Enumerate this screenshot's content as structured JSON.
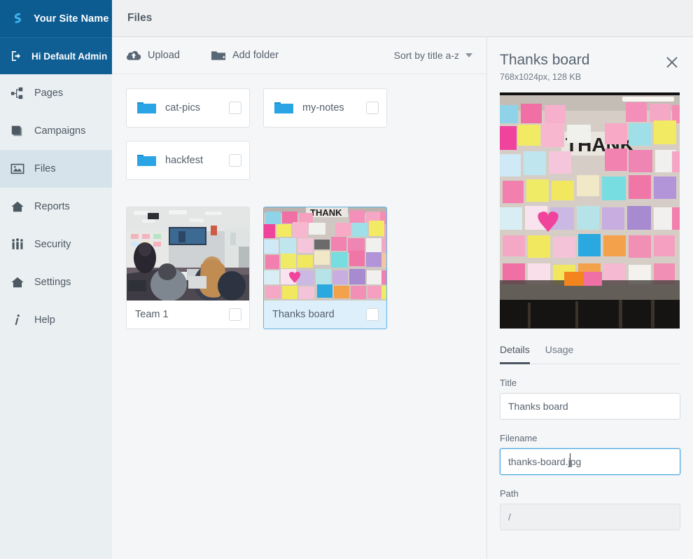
{
  "brand": {
    "logo_icon": "s-swirl-logo",
    "name": "Your Site Name",
    "user_icon": "logout-arrow-icon",
    "user_greeting": "Hi Default Admin",
    "header_bg": "#0d5c91",
    "accent": "#29a3e0"
  },
  "sidebar": {
    "items": [
      {
        "label": "Pages",
        "icon": "sitemap-icon",
        "active": false
      },
      {
        "label": "Campaigns",
        "icon": "layers-icon",
        "active": false
      },
      {
        "label": "Files",
        "icon": "image-icon",
        "active": true
      },
      {
        "label": "Reports",
        "icon": "home-icon",
        "active": false
      },
      {
        "label": "Security",
        "icon": "people-icon",
        "active": false
      },
      {
        "label": "Settings",
        "icon": "home-icon",
        "active": false
      },
      {
        "label": "Help",
        "icon": "info-i-icon",
        "active": false
      }
    ]
  },
  "page": {
    "title": "Files"
  },
  "toolbar": {
    "upload_label": "Upload",
    "upload_icon": "cloud-upload-icon",
    "add_folder_label": "Add folder",
    "add_folder_icon": "folder-plus-icon",
    "sort_label": "Sort by title a-z",
    "sort_caret_icon": "chevron-down-icon"
  },
  "grid": {
    "folders": [
      {
        "name": "cat-pics",
        "checked": false
      },
      {
        "name": "my-notes",
        "checked": false
      },
      {
        "name": "hackfest",
        "checked": false
      }
    ],
    "files": [
      {
        "name": "Team 1",
        "checked": false,
        "selected": false,
        "thumb": "office-hackathon-photo"
      },
      {
        "name": "Thanks board",
        "checked": false,
        "selected": true,
        "thumb": "sticky-notes-wall-photo"
      }
    ]
  },
  "detail": {
    "title": "Thanks board",
    "meta": "768x1024px, 128 KB",
    "close_icon": "close-icon",
    "preview_image": "sticky-notes-wall-photo",
    "tabs": [
      {
        "label": "Details",
        "active": true
      },
      {
        "label": "Usage",
        "active": false
      }
    ],
    "fields": [
      {
        "label": "Title",
        "value": "Thanks board",
        "placeholder": "Title",
        "focused": false,
        "disabled": false
      },
      {
        "label": "Filename",
        "value": "thanks-board.jpg",
        "placeholder": "Filename",
        "focused": true,
        "disabled": false
      },
      {
        "label": "Path",
        "value": "/",
        "placeholder": "Path",
        "focused": false,
        "disabled": true
      }
    ]
  }
}
